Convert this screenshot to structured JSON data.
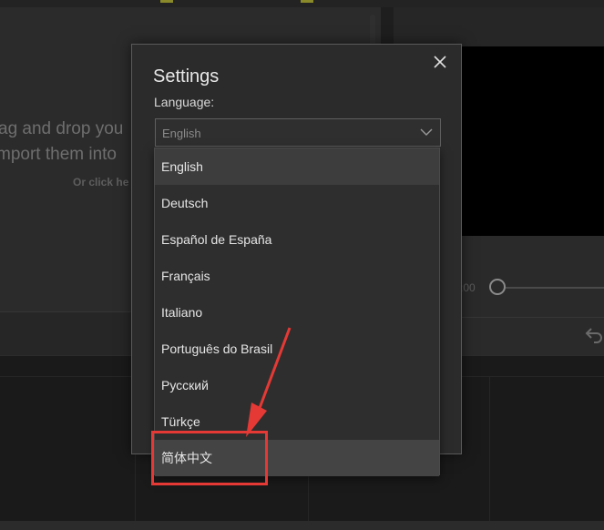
{
  "background": {
    "drop_line1": "ag and drop you",
    "drop_line2": "mport them into",
    "drop_hint": "Or click he",
    "time_fragment": ":00",
    "undo_icon": "undo-icon"
  },
  "dialog": {
    "title": "Settings",
    "close_icon": "close-icon",
    "language_label": "Language:",
    "selected_language": "English",
    "options": [
      "English",
      "Deutsch",
      "Español de España",
      "Français",
      "Italiano",
      "Português do Brasil",
      "Русский",
      "Türkçe",
      "简体中文"
    ]
  },
  "colors": {
    "annotation": "#e53935",
    "dialog_bg": "#2b2b2b",
    "option_selected_bg": "#3d3d3d",
    "option_hover_bg": "#444444"
  }
}
